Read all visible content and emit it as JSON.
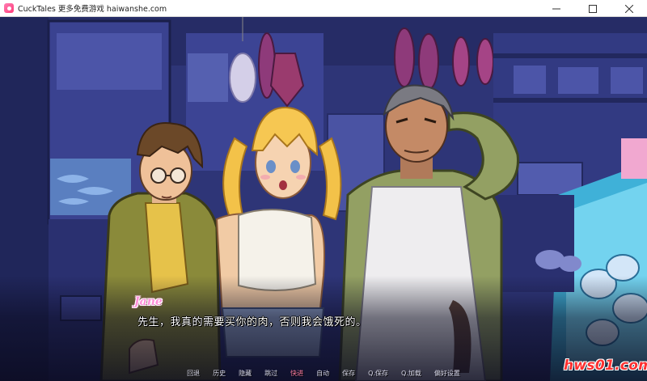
{
  "window": {
    "title": "CuckTales 更多免费游戏 haiwanshe.com",
    "controls": [
      "minimize-icon",
      "maximize-icon",
      "close-icon"
    ]
  },
  "dialogue": {
    "speaker": "Jane",
    "text": "先生，我真的需要买你的肉，否则我会饿死的。",
    "speaker_color": "#ff8fd8"
  },
  "quick_menu": {
    "items": [
      {
        "label": "回退",
        "active": false
      },
      {
        "label": "历史",
        "active": false
      },
      {
        "label": "隐藏",
        "active": false
      },
      {
        "label": "跳过",
        "active": false
      },
      {
        "label": "快进",
        "active": true
      },
      {
        "label": "自动",
        "active": false
      },
      {
        "label": "保存",
        "active": false
      },
      {
        "label": "Q.保存",
        "active": false
      },
      {
        "label": "Q.加载",
        "active": false
      },
      {
        "label": "偏好设置",
        "active": false
      }
    ],
    "active_color": "#ff7ea0"
  },
  "watermark": {
    "text": "hws01.com",
    "color": "#ff3030"
  }
}
